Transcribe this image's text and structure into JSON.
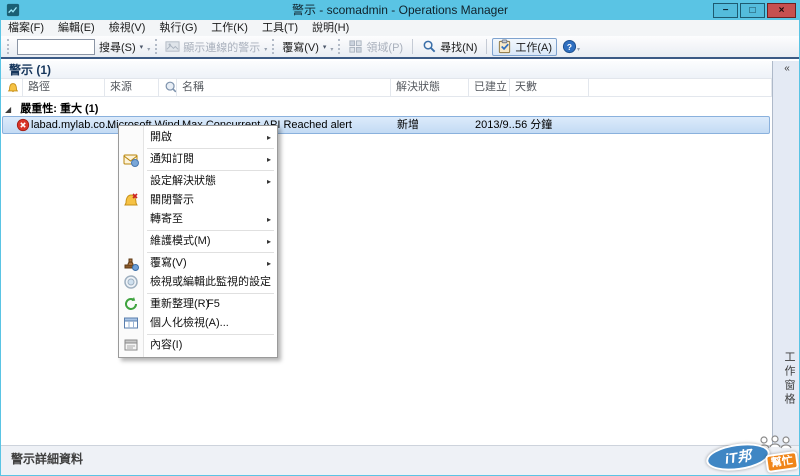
{
  "window": {
    "title": "警示 - scomadmin - Operations Manager",
    "minimize_glyph": "−",
    "restore_glyph": "□",
    "close_glyph": "×"
  },
  "menubar": {
    "items": [
      "檔案(F)",
      "編輯(E)",
      "檢視(V)",
      "執行(G)",
      "工作(K)",
      "工具(T)",
      "說明(H)"
    ]
  },
  "toolbar": {
    "search_value": "",
    "search_label": "搜尋(S)",
    "show_connected_label": "顯示連線的警示",
    "overrides_label": "覆寫(V)",
    "scope_label": "領域(P)",
    "find_label": "尋找(N)",
    "tasks_label": "工作(A)"
  },
  "view": {
    "title": "警示 (1)"
  },
  "columns": [
    {
      "label": "",
      "icon": "alert-bell-icon"
    },
    {
      "label": "路徑"
    },
    {
      "label": "來源"
    },
    {
      "label": "",
      "icon": "magnifier-wrench-icon"
    },
    {
      "label": "名稱"
    },
    {
      "label": "解決狀態"
    },
    {
      "label": "已建立"
    },
    {
      "label": "天數"
    },
    {
      "label": ""
    }
  ],
  "group": {
    "label": "嚴重性: 重大 (1)"
  },
  "alert_row": {
    "path": "labad.mylab.co...",
    "source": "Microsoft Wind...",
    "name": "Max Concurrent API Reached alert",
    "state": "新增",
    "created": "2013/9...",
    "age": "56 分鐘"
  },
  "context_menu": {
    "items": [
      {
        "label": "開啟",
        "submenu": true
      },
      {
        "separator": true
      },
      {
        "label": "通知訂閱",
        "icon": "notification-icon",
        "submenu": true
      },
      {
        "separator": true
      },
      {
        "label": "設定解決狀態",
        "submenu": true
      },
      {
        "label": "關閉警示",
        "icon": "close-alert-icon"
      },
      {
        "label": "轉寄至",
        "submenu": true
      },
      {
        "separator": true
      },
      {
        "label": "維護模式(M)",
        "submenu": true
      },
      {
        "separator": true
      },
      {
        "label": "覆寫(V)",
        "icon": "override-icon",
        "submenu": true
      },
      {
        "label": "檢視或編輯此監視的設定",
        "icon": "monitor-settings-icon"
      },
      {
        "separator": true
      },
      {
        "label": "重新整理(R)",
        "icon": "refresh-icon",
        "shortcut": "F5"
      },
      {
        "label": "個人化檢視(A)...",
        "icon": "personalize-view-icon"
      },
      {
        "separator": true
      },
      {
        "label": "內容(I)",
        "icon": "properties-icon"
      }
    ]
  },
  "taskpane": {
    "label": "工作窗格"
  },
  "bottom": {
    "label": "警示詳細資料"
  },
  "watermark": {
    "line1": "iT邦",
    "line2": "幫忙"
  },
  "glyphs": {
    "collapse": "«",
    "dropdown": "▾",
    "submenu": "▸",
    "group_expanded": "◢",
    "overflow": "▾"
  },
  "colors": {
    "titlebar": "#5ac4e4",
    "close_button": "#c75050",
    "toolbar_border": "#3b5a85",
    "selection_start": "#dcebfb",
    "selection_end": "#c3dbf4",
    "selection_border": "#8ab1dd",
    "critical": "#d9352a",
    "taskpane": "#e4eaf4",
    "watermark_blue": "#3f86c4",
    "watermark_orange": "#f08519"
  }
}
